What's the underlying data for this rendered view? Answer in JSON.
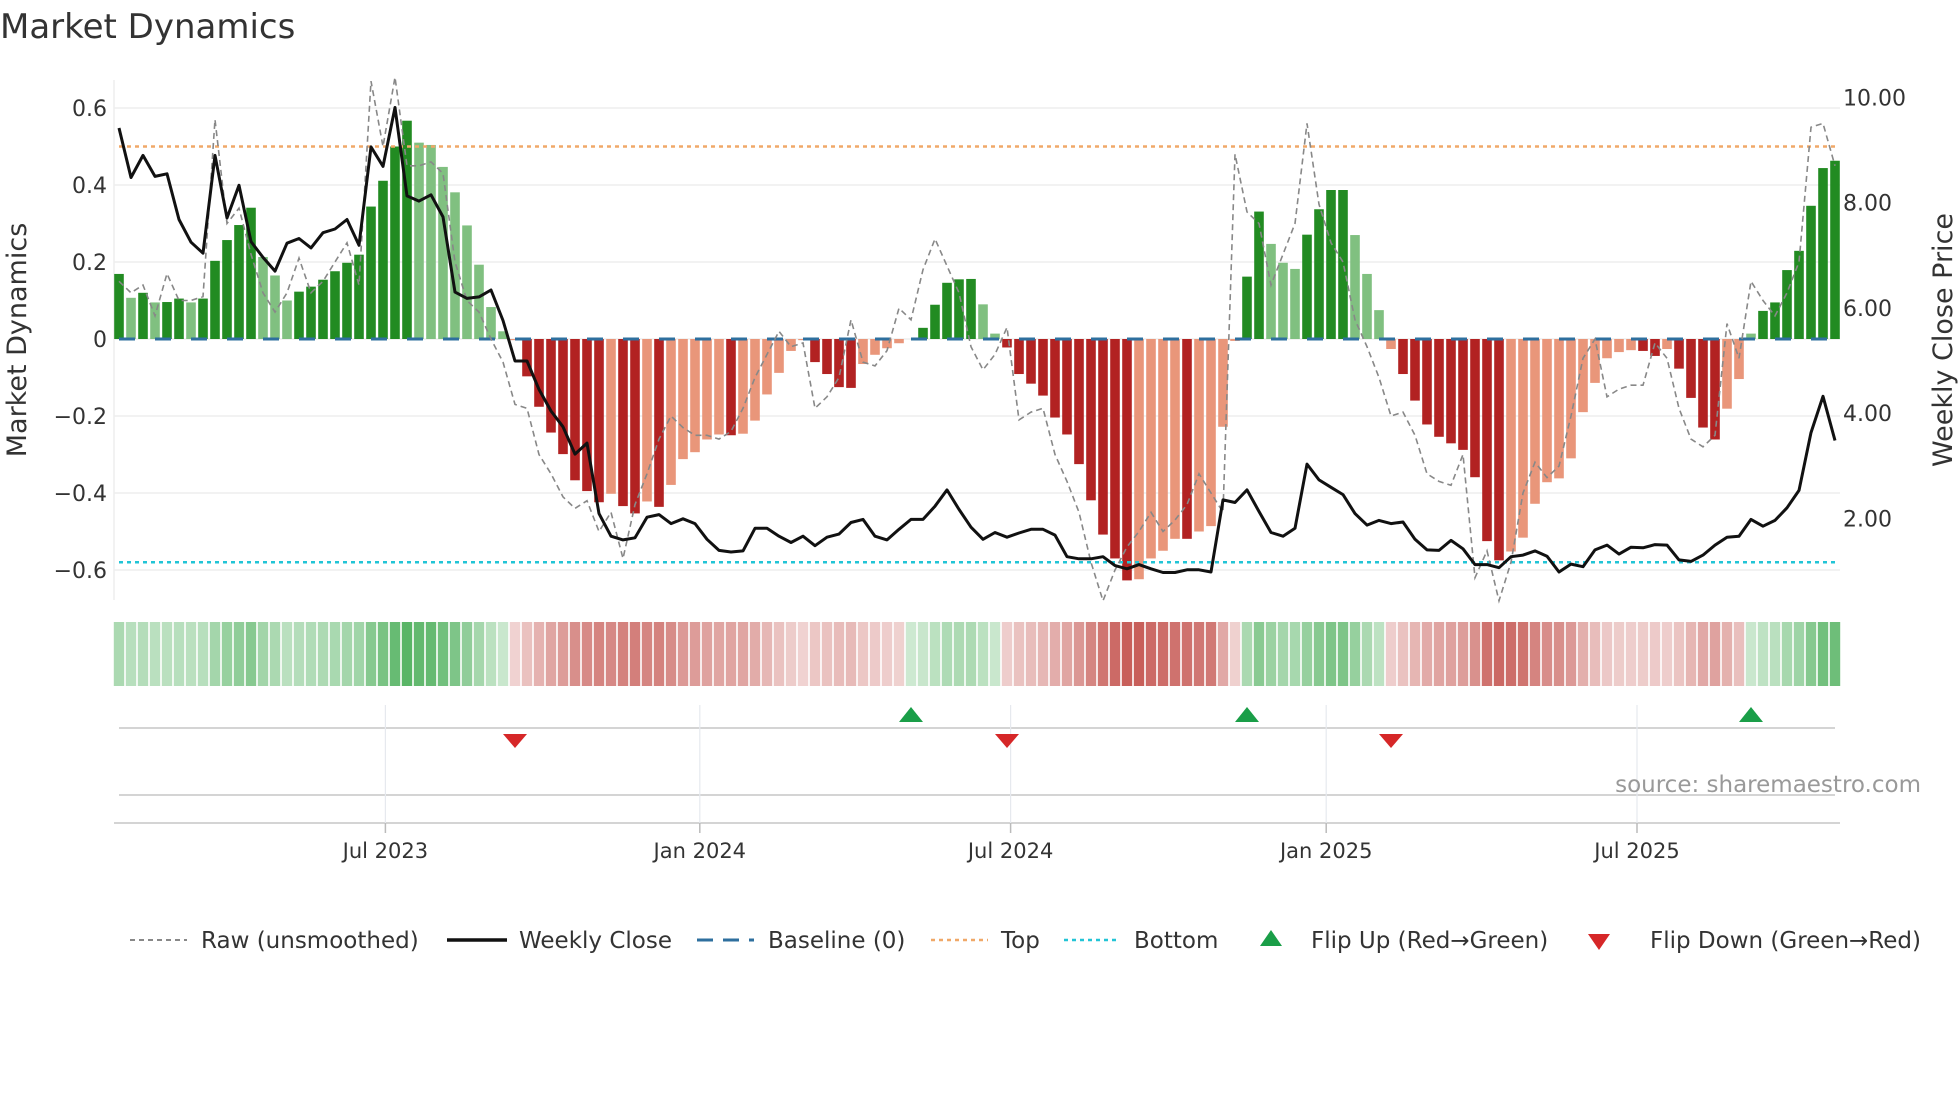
{
  "chart_data": {
    "type": "bar",
    "title": "Market Dynamics",
    "ylabel": "Market Dynamics",
    "y2label": "Weekly Close Price",
    "ylim": [
      -0.68,
      0.68
    ],
    "y2lim": [
      0,
      10.4
    ],
    "yticks": [
      {
        "value": 0.6,
        "label": "0.6"
      },
      {
        "value": 0.4,
        "label": "0.4"
      },
      {
        "value": 0.2,
        "label": "0.2"
      },
      {
        "value": 0,
        "label": "0"
      },
      {
        "value": -0.2,
        "label": "−0.2"
      },
      {
        "value": -0.4,
        "label": "−0.4"
      },
      {
        "value": -0.6,
        "label": "−0.6"
      }
    ],
    "y2ticks": [
      {
        "value": 10,
        "label": "10.00"
      },
      {
        "value": 8,
        "label": "8.00"
      },
      {
        "value": 6,
        "label": "6.00"
      },
      {
        "value": 4,
        "label": "4.00"
      },
      {
        "value": 2,
        "label": "2.00"
      }
    ],
    "xticks": [
      {
        "week": 22.2,
        "label": "Jul 2023"
      },
      {
        "week": 48.4,
        "label": "Jan 2024"
      },
      {
        "week": 74.3,
        "label": "Jul 2024"
      },
      {
        "week": 100.6,
        "label": "Jan 2025"
      },
      {
        "week": 126.5,
        "label": "Jul 2025"
      }
    ],
    "top_level": 0.5,
    "bottom_level": -0.58,
    "baseline": 0,
    "momentum": [
      0.169,
      0.107,
      0.12,
      0.095,
      0.096,
      0.105,
      0.095,
      0.105,
      0.203,
      0.257,
      0.296,
      0.341,
      0.213,
      0.165,
      0.1,
      0.123,
      0.136,
      0.154,
      0.176,
      0.198,
      0.219,
      0.344,
      0.411,
      0.5,
      0.567,
      0.51,
      0.504,
      0.447,
      0.381,
      0.295,
      0.193,
      0.083,
      0.02,
      -0.003,
      -0.097,
      -0.176,
      -0.243,
      -0.299,
      -0.367,
      -0.395,
      -0.424,
      -0.402,
      -0.434,
      -0.453,
      -0.422,
      -0.436,
      -0.379,
      -0.312,
      -0.294,
      -0.261,
      -0.248,
      -0.25,
      -0.246,
      -0.212,
      -0.144,
      -0.088,
      -0.031,
      -0.003,
      -0.06,
      -0.091,
      -0.125,
      -0.127,
      -0.065,
      -0.041,
      -0.024,
      -0.011,
      0.0,
      0.029,
      0.089,
      0.146,
      0.155,
      0.156,
      0.09,
      0.014,
      -0.022,
      -0.091,
      -0.116,
      -0.147,
      -0.204,
      -0.248,
      -0.325,
      -0.419,
      -0.508,
      -0.57,
      -0.627,
      -0.624,
      -0.57,
      -0.55,
      -0.519,
      -0.519,
      -0.5,
      -0.486,
      -0.228,
      -0.005,
      0.162,
      0.331,
      0.247,
      0.198,
      0.182,
      0.271,
      0.337,
      0.387,
      0.387,
      0.27,
      0.169,
      0.075,
      -0.026,
      -0.091,
      -0.16,
      -0.222,
      -0.254,
      -0.271,
      -0.288,
      -0.359,
      -0.525,
      -0.575,
      -0.552,
      -0.516,
      -0.428,
      -0.372,
      -0.362,
      -0.31,
      -0.19,
      -0.114,
      -0.05,
      -0.034,
      -0.029,
      -0.031,
      -0.044,
      -0.026,
      -0.077,
      -0.153,
      -0.23,
      -0.261,
      -0.181,
      -0.104,
      0.014,
      0.073,
      0.095,
      0.179,
      0.229,
      0.346,
      0.444,
      0.463
    ],
    "raw": [
      0.15,
      0.12,
      0.14,
      0.06,
      0.17,
      0.1,
      0.1,
      0.11,
      0.57,
      0.3,
      0.34,
      0.22,
      0.12,
      0.07,
      0.12,
      0.21,
      0.12,
      0.15,
      0.2,
      0.25,
      0.14,
      0.67,
      0.5,
      0.68,
      0.45,
      0.45,
      0.46,
      0.43,
      0.2,
      0.1,
      0.07,
      0.0,
      -0.06,
      -0.17,
      -0.18,
      -0.3,
      -0.35,
      -0.41,
      -0.44,
      -0.42,
      -0.5,
      -0.45,
      -0.57,
      -0.43,
      -0.35,
      -0.26,
      -0.2,
      -0.23,
      -0.25,
      -0.25,
      -0.26,
      -0.24,
      -0.18,
      -0.1,
      -0.04,
      0.02,
      -0.02,
      -0.01,
      -0.18,
      -0.15,
      -0.1,
      0.05,
      -0.06,
      -0.07,
      -0.03,
      0.08,
      0.05,
      0.18,
      0.26,
      0.19,
      0.12,
      -0.02,
      -0.08,
      -0.04,
      0.03,
      -0.21,
      -0.19,
      -0.18,
      -0.3,
      -0.37,
      -0.45,
      -0.58,
      -0.68,
      -0.6,
      -0.54,
      -0.5,
      -0.45,
      -0.5,
      -0.47,
      -0.43,
      -0.35,
      -0.4,
      -0.45,
      0.48,
      0.33,
      0.3,
      0.14,
      0.22,
      0.3,
      0.56,
      0.35,
      0.25,
      0.2,
      0.05,
      -0.02,
      -0.1,
      -0.2,
      -0.19,
      -0.25,
      -0.35,
      -0.37,
      -0.38,
      -0.3,
      -0.62,
      -0.55,
      -0.68,
      -0.58,
      -0.4,
      -0.32,
      -0.36,
      -0.33,
      -0.2,
      -0.05,
      0.0,
      -0.15,
      -0.13,
      -0.12,
      -0.12,
      -0.01,
      -0.05,
      -0.18,
      -0.26,
      -0.28,
      -0.25,
      0.04,
      -0.05,
      0.15,
      0.1,
      0.06,
      0.12,
      0.2,
      0.55,
      0.56,
      0.45
    ],
    "weekly_close": [
      9.42,
      8.48,
      8.9,
      8.5,
      8.55,
      7.68,
      7.25,
      7.04,
      8.9,
      7.71,
      8.33,
      7.26,
      6.96,
      6.7,
      7.23,
      7.32,
      7.14,
      7.43,
      7.5,
      7.68,
      7.19,
      9.06,
      8.69,
      9.81,
      8.13,
      8.03,
      8.15,
      7.73,
      6.3,
      6.18,
      6.21,
      6.34,
      5.76,
      4.99,
      4.99,
      4.45,
      4.04,
      3.74,
      3.22,
      3.43,
      2.09,
      1.66,
      1.59,
      1.63,
      2.02,
      2.07,
      1.9,
      1.99,
      1.9,
      1.6,
      1.39,
      1.36,
      1.38,
      1.81,
      1.81,
      1.66,
      1.54,
      1.66,
      1.48,
      1.64,
      1.7,
      1.92,
      1.98,
      1.66,
      1.59,
      1.79,
      1.98,
      1.98,
      2.23,
      2.54,
      2.17,
      1.83,
      1.6,
      1.73,
      1.64,
      1.72,
      1.79,
      1.79,
      1.68,
      1.27,
      1.23,
      1.23,
      1.27,
      1.1,
      1.04,
      1.12,
      1.04,
      0.97,
      0.97,
      1.02,
      1.02,
      0.98,
      2.35,
      2.3,
      2.54,
      2.13,
      1.73,
      1.66,
      1.81,
      3.03,
      2.73,
      2.59,
      2.45,
      2.09,
      1.87,
      1.96,
      1.9,
      1.93,
      1.6,
      1.4,
      1.39,
      1.58,
      1.42,
      1.12,
      1.12,
      1.06,
      1.27,
      1.3,
      1.38,
      1.28,
      0.98,
      1.13,
      1.08,
      1.4,
      1.49,
      1.32,
      1.45,
      1.44,
      1.5,
      1.49,
      1.21,
      1.18,
      1.3,
      1.49,
      1.64,
      1.66,
      1.98,
      1.85,
      1.96,
      2.2,
      2.53,
      3.63,
      4.32,
      3.48
    ],
    "flip_up_weeks": [
      66,
      94,
      136
    ],
    "flip_down_weeks": [
      33,
      74,
      106
    ],
    "legend": {
      "position": "bottom",
      "raw": "Raw (unsmoothed)",
      "close": "Weekly Close",
      "baseline": "Baseline (0)",
      "top": "Top",
      "bottom": "Bottom",
      "flip_up": "Flip Up (Red→Green)",
      "flip_down": "Flip Down (Green→Red)"
    }
  },
  "source": "source: sharemaestro.com",
  "colors": {
    "up_strong": "#228b22",
    "up_weak": "#80c080",
    "down_strong": "#b22222",
    "down_weak": "#e9967a",
    "raw": "#888888",
    "close": "#111111",
    "baseline": "#2e6f9e",
    "top": "#f0a868",
    "bottom": "#22c4d6",
    "flip_up": "#1a9e48",
    "flip_down": "#d62728"
  }
}
